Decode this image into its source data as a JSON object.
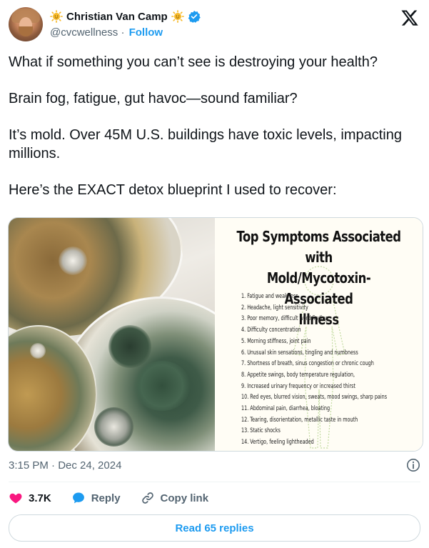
{
  "author": {
    "name": "Christian Van Camp",
    "handle": "@cvcwellness",
    "separator": "·",
    "follow_label": "Follow"
  },
  "tweet": {
    "paragraphs": [
      "What if something you can’t see is destroying your health?",
      "Brain fog, fatigue, gut havoc—sound familiar?",
      "It’s mold. Over 45M U.S. buildings have toxic levels, impacting millions.",
      "Here’s the EXACT detox blueprint I used to recover:"
    ]
  },
  "infographic": {
    "title_line1": "Top Symptoms Associated with",
    "title_line2": "Mold/Mycotoxin-Associated",
    "title_line3": "Illness",
    "symptoms": [
      "1. Fatigue and weakness",
      "2. Headache, light sensitivity",
      "3. Poor memory, difficult word finding",
      "4. Difficulty concentration",
      "5. Morning stiffness, joint pain",
      "6. Unusual skin sensations, tingling and numbness",
      "7. Shortness of breath, sinus congestion or chronic cough",
      "8. Appetite swings, body temperature regulation,",
      "9. Increased urinary frequency or increased thirst",
      "10. Red eyes, blurred vision, sweats, mood swings, sharp pains",
      "11. Abdominal pain, diarrhea, bloating",
      "12. Tearing, disorientation, metallic taste in mouth",
      "13. Static shocks",
      "14. Vertigo, feeling lightheaded"
    ]
  },
  "meta": {
    "timestamp": "3:15 PM · Dec 24, 2024"
  },
  "actions": {
    "likes": "3.7K",
    "reply_label": "Reply",
    "copy_link_label": "Copy link"
  },
  "read_replies_label": "Read 65 replies",
  "colors": {
    "accent": "#1d9bf0",
    "like": "#f91880",
    "secondary_text": "#536471",
    "verified": "#1d9bf0"
  },
  "icons": {
    "sun_emoji": "sun-emoji-icon",
    "verified": "verified-badge-icon",
    "platform_logo": "x-logo-icon",
    "info": "info-icon",
    "like": "heart-icon",
    "reply": "speech-bubble-icon",
    "copy_link": "link-icon"
  }
}
